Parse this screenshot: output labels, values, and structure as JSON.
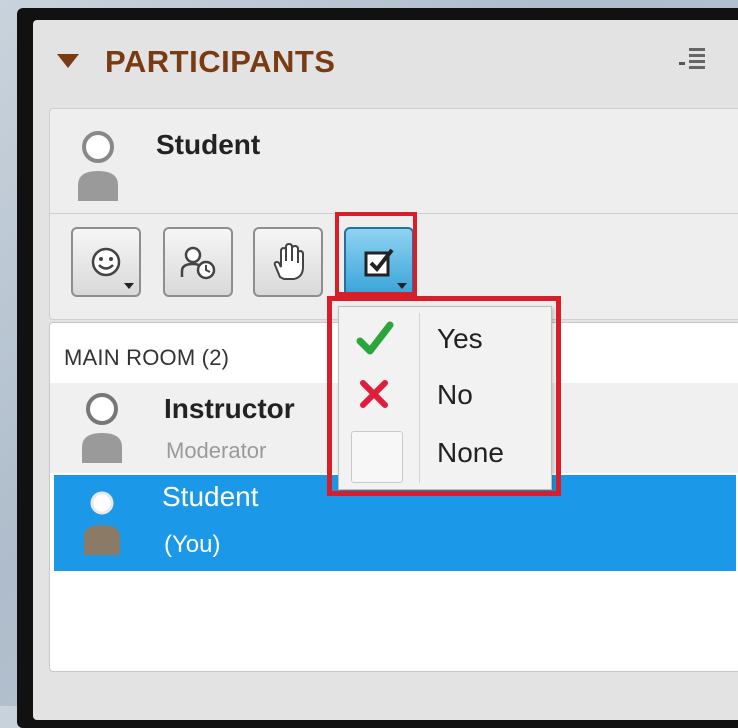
{
  "panel": {
    "title": "PARTICIPANTS",
    "self_name": "Student",
    "toolbar": {
      "buttons": [
        {
          "name": "emoticon",
          "icon": "smiley-icon"
        },
        {
          "name": "away",
          "icon": "away-clock-icon"
        },
        {
          "name": "raise-hand",
          "icon": "raise-hand-icon"
        },
        {
          "name": "agree-disagree",
          "icon": "checkbox-icon",
          "active": true
        }
      ]
    },
    "room": {
      "label": "MAIN ROOM (2)",
      "participants": [
        {
          "name": "Instructor",
          "role": "Moderator"
        },
        {
          "name": "Student",
          "role": "(You)",
          "selected": true
        }
      ]
    },
    "status_menu": {
      "items": [
        {
          "label": "Yes",
          "icon": "check-icon",
          "color": "#2aa63a"
        },
        {
          "label": "No",
          "icon": "x-icon",
          "color": "#e01e3c"
        },
        {
          "label": "None",
          "icon": "empty-box-icon"
        }
      ]
    },
    "colors": {
      "title": "#7a3a12",
      "selection": "#1c98e8",
      "highlight": "#d91e2a"
    }
  }
}
